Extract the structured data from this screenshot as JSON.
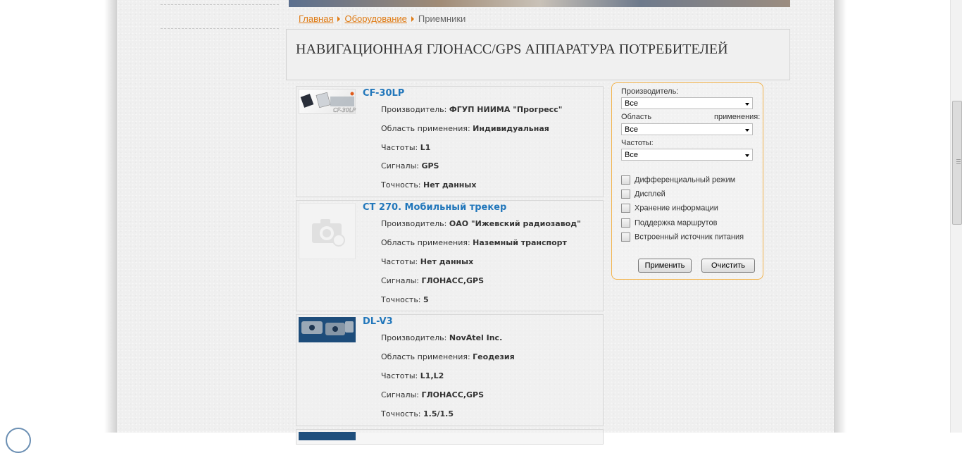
{
  "breadcrumb": {
    "home": "Главная",
    "equipment": "Оборудование",
    "current": "Приемники"
  },
  "page_title": "НАВИГАЦИОННАЯ ГЛОНАСС/GPS АППАРАТУРА ПОТРЕБИТЕЛЕЙ",
  "labels": {
    "manufacturer": "Производитель:",
    "area": "Область применения:",
    "frequencies": "Частоты:",
    "signals": "Сигналы:",
    "accuracy": "Точность:"
  },
  "products": [
    {
      "name": "CF-30LP",
      "thumb_text": "CF-30LP",
      "manufacturer": "ФГУП НИИМА \"Прогресс\"",
      "area": "Индивидуальная",
      "frequencies": "L1",
      "signals": "GPS",
      "accuracy": "Нет данных"
    },
    {
      "name": "CT 270. Мобильный трекер",
      "manufacturer": "ОАО \"Ижевский радиозавод\"",
      "area": "Наземный транспорт",
      "frequencies": "Нет данных",
      "signals": "ГЛОНАСС,GPS",
      "accuracy": "5"
    },
    {
      "name": "DL-V3",
      "manufacturer": "NovAtel Inc.",
      "area": "Геодезия",
      "frequencies": "L1,L2",
      "signals": "ГЛОНАСС,GPS",
      "accuracy": "1.5/1.5"
    }
  ],
  "filter": {
    "manufacturer_label": "Производитель:",
    "manufacturer_value": "Все",
    "area_label_1": "Область",
    "area_label_2": "применения:",
    "area_value": "Все",
    "freq_label": "Частоты:",
    "freq_value": "Все",
    "checkboxes": [
      "Дифференциальный режим",
      "Дисплей",
      "Хранение информации",
      "Поддержка маршрутов",
      "Встроенный источник питания"
    ],
    "apply_label": "Применить",
    "clear_label": "Очистить"
  },
  "colors": {
    "link": "#e07b14",
    "product_link": "#2277bb",
    "filter_border": "#f2b34c"
  }
}
